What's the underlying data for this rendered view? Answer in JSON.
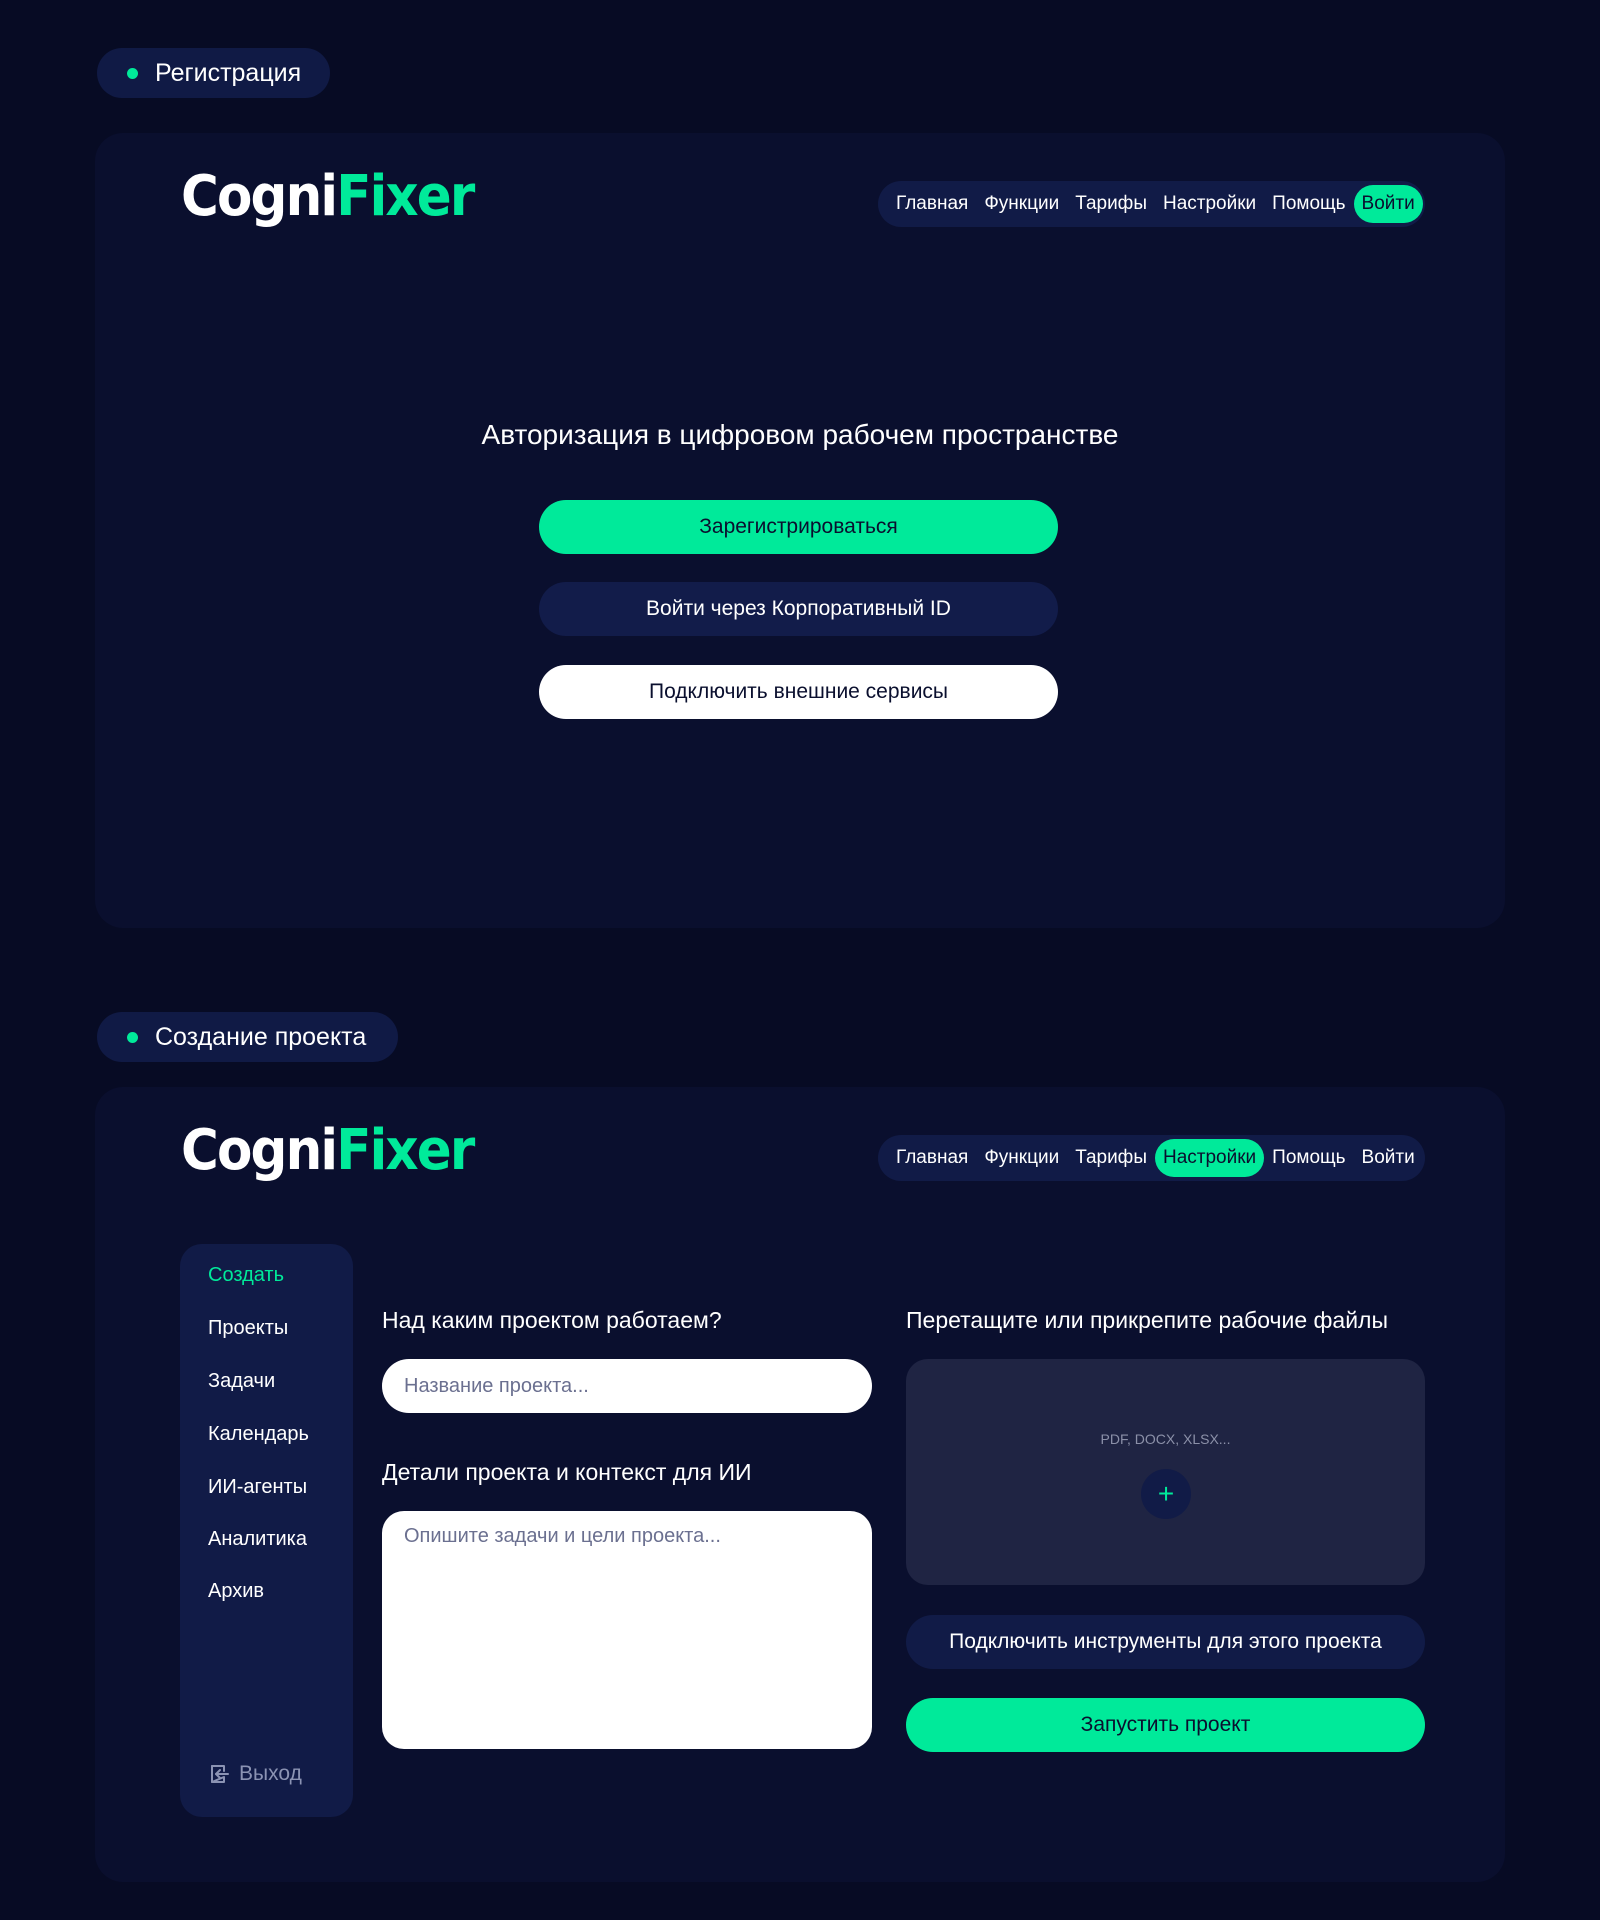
{
  "sections": {
    "registration_tag": "Регистрация",
    "project_tag": "Создание проекта"
  },
  "brand": {
    "name_part1": "Cogni",
    "name_part2": "Fixer",
    "accent_color": "#00ea9a",
    "background_color": "#070b24"
  },
  "nav1": {
    "items": [
      "Главная",
      "Функции",
      "Тарифы",
      "Настройки",
      "Помощь",
      "Войти"
    ],
    "active": "Войти"
  },
  "nav2": {
    "items": [
      "Главная",
      "Функции",
      "Тарифы",
      "Настройки",
      "Помощь",
      "Войти"
    ],
    "active": "Настройки"
  },
  "auth": {
    "title": "Авторизация в цифровом рабочем пространстве",
    "register_label": "Зарегистрироваться",
    "corp_id_label": "Войти через Корпоративный ID",
    "external_label": "Подключить внешние сервисы"
  },
  "sidebar": {
    "items": [
      "Создать",
      "Проекты",
      "Задачи",
      "Календарь",
      "ИИ-агенты",
      "Аналитика",
      "Архив"
    ],
    "active": "Создать",
    "logout_label": "Выход",
    "logout_icon": "logout-icon"
  },
  "project_form": {
    "project_question": "Над каким проектом работаем?",
    "project_name_placeholder": "Название проекта...",
    "project_name_value": "",
    "details_label": "Детали проекта и контекст для ИИ",
    "details_placeholder": "Опишите задачи и цели проекта...",
    "details_value": "",
    "files_label": "Перетащите или прикрепите рабочие файлы",
    "file_formats": "PDF, DOCX, XLSX...",
    "add_file_icon": "plus-icon",
    "add_file_symbol": "+",
    "tools_label": "Подключить инструменты для этого проекта",
    "launch_label": "Запустить проект"
  }
}
